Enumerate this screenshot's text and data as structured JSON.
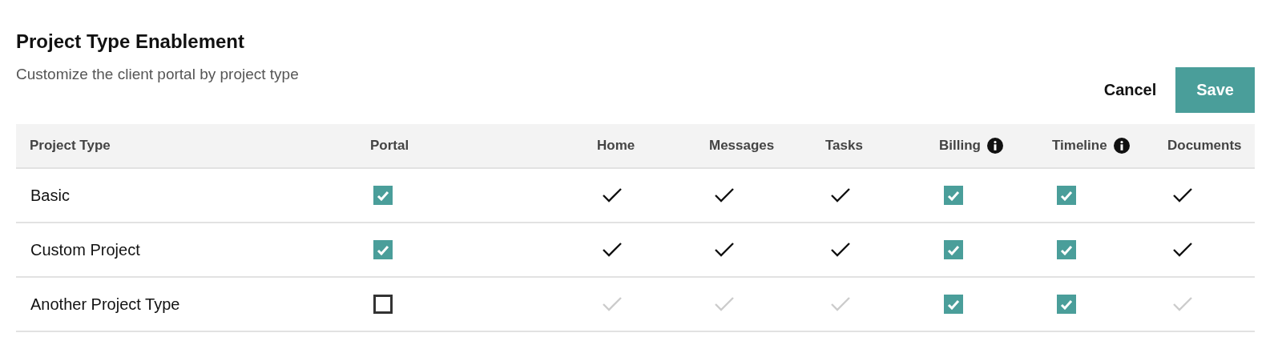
{
  "header": {
    "title": "Project Type Enablement",
    "subtitle": "Customize the client portal by project type"
  },
  "buttons": [
    {
      "kind": "secondary",
      "label": "Cancel"
    },
    {
      "kind": "primary",
      "label": "Save"
    }
  ],
  "table": {
    "columns": [
      {
        "label": "Project Type",
        "info": false
      },
      {
        "label": "Portal",
        "info": false
      },
      {
        "label": "Home",
        "info": false
      },
      {
        "label": "Messages",
        "info": false
      },
      {
        "label": "Tasks",
        "info": false
      },
      {
        "label": "Billing",
        "info": true
      },
      {
        "label": "Timeline",
        "info": true
      },
      {
        "label": "Documents",
        "info": false
      }
    ],
    "rows": [
      {
        "name": "Basic",
        "cells": [
          {
            "kind": "checkbox",
            "checked": true
          },
          {
            "kind": "check",
            "enabled": true
          },
          {
            "kind": "check",
            "enabled": true
          },
          {
            "kind": "check",
            "enabled": true
          },
          {
            "kind": "checkbox",
            "checked": true
          },
          {
            "kind": "checkbox",
            "checked": true
          },
          {
            "kind": "check",
            "enabled": true
          }
        ]
      },
      {
        "name": "Custom Project",
        "cells": [
          {
            "kind": "checkbox",
            "checked": true
          },
          {
            "kind": "check",
            "enabled": true
          },
          {
            "kind": "check",
            "enabled": true
          },
          {
            "kind": "check",
            "enabled": true
          },
          {
            "kind": "checkbox",
            "checked": true
          },
          {
            "kind": "checkbox",
            "checked": true
          },
          {
            "kind": "check",
            "enabled": true
          }
        ]
      },
      {
        "name": "Another Project Type",
        "cells": [
          {
            "kind": "checkbox",
            "checked": false
          },
          {
            "kind": "check",
            "enabled": false
          },
          {
            "kind": "check",
            "enabled": false
          },
          {
            "kind": "check",
            "enabled": false
          },
          {
            "kind": "checkbox",
            "checked": true
          },
          {
            "kind": "checkbox",
            "checked": true
          },
          {
            "kind": "check",
            "enabled": false
          }
        ]
      }
    ]
  }
}
